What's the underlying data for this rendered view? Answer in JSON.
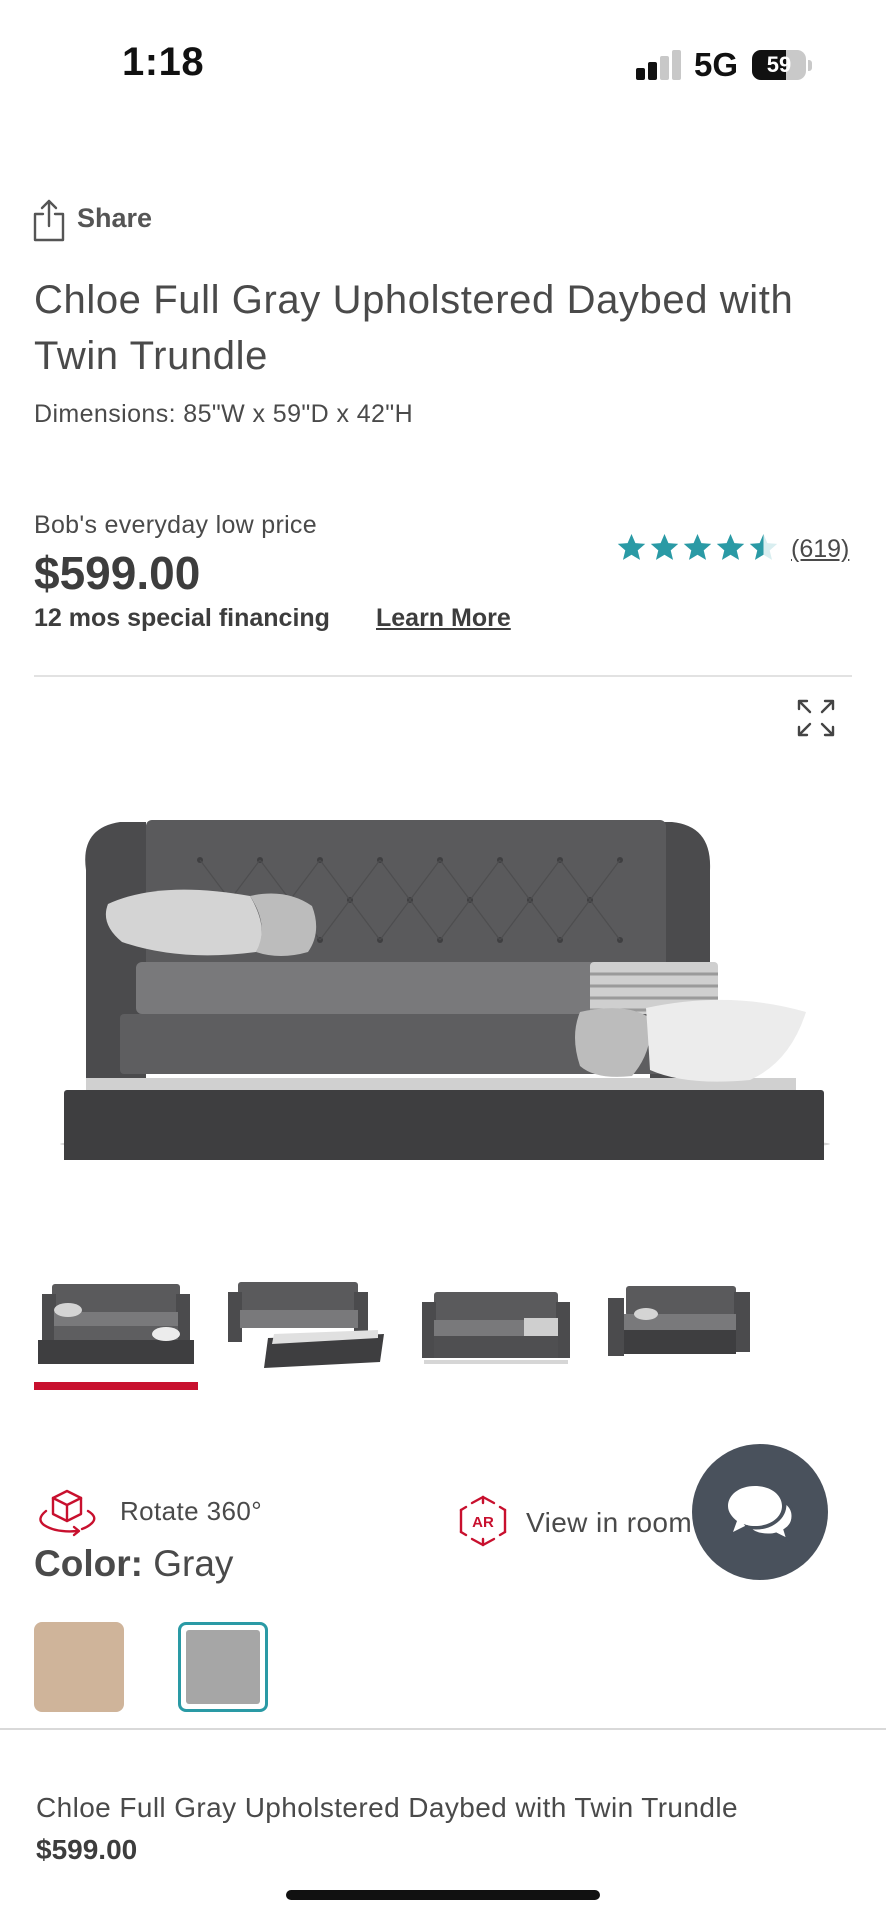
{
  "status_bar": {
    "time": "1:18",
    "network": "5G",
    "battery": "59"
  },
  "share": {
    "label": "Share"
  },
  "product": {
    "title": "Chloe Full Gray Upholstered Daybed with Twin Trundle",
    "dimensions": "Dimensions: 85\"W x 59\"D x 42\"H",
    "price_label": "Bob's everyday low price",
    "price": "$599.00",
    "financing": "12 mos special financing",
    "learn_more": "Learn More",
    "rating": 4.5,
    "reviews": "(619)",
    "star_color": "#2a9aa5"
  },
  "gallery": {
    "thumbnail_count": 4,
    "selected_index": 0,
    "accent": "#c8102e"
  },
  "features": {
    "rotate_label": "Rotate 360°",
    "ar_label": "View in room",
    "ar_badge": "AR"
  },
  "color": {
    "label": "Color:",
    "value": "Gray",
    "swatches": [
      {
        "name": "Tan",
        "hex": "#cfb49a"
      },
      {
        "name": "Gray",
        "hex": "#a6a6a6",
        "selected": true
      }
    ]
  },
  "sticky_bar": {
    "title": "Chloe Full Gray Upholstered Daybed with Twin Trundle",
    "price": "$599.00"
  }
}
